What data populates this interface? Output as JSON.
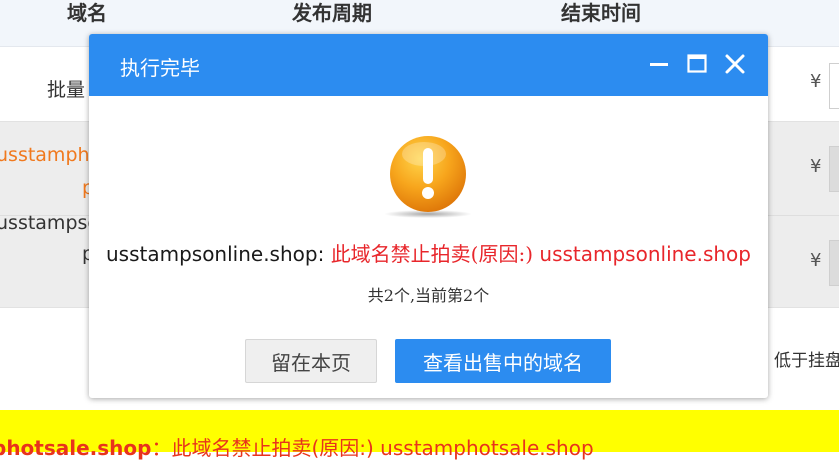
{
  "table": {
    "headers": [
      "域名",
      "发布周期",
      "结束时间"
    ],
    "rows": [
      {
        "name_partial": "批量"
      },
      {
        "name_line1": "usstampho",
        "name_line2": "p"
      },
      {
        "name_line1": "usstampso",
        "name_line2": "p"
      }
    ],
    "currency": "¥",
    "low_price_text": "低于挂盘",
    "bottom_banner": {
      "domain": "phot​sale.shop",
      "separator": "：",
      "message": "此域名禁止拍卖(原因:) usstamphotsale.shop"
    }
  },
  "modal": {
    "title": "执行完毕",
    "icons": {
      "minimize": "minimize-icon",
      "maximize": "maximize-icon",
      "close": "close-icon",
      "warning": "warning-icon"
    },
    "message_domain": "usstampsonline.shop:",
    "message_reason": "此域名禁止拍卖(原因:)",
    "message_reason_domain": "usstampsonline.shop",
    "count_text": "共2个,当前第2个",
    "stay_button": "留在本页",
    "view_button": "查看出售中的域名"
  },
  "colors": {
    "accent": "#2c8cf0",
    "error_red": "#e8262b",
    "orange": "#f0791e",
    "banner_yellow": "#ffff00"
  }
}
